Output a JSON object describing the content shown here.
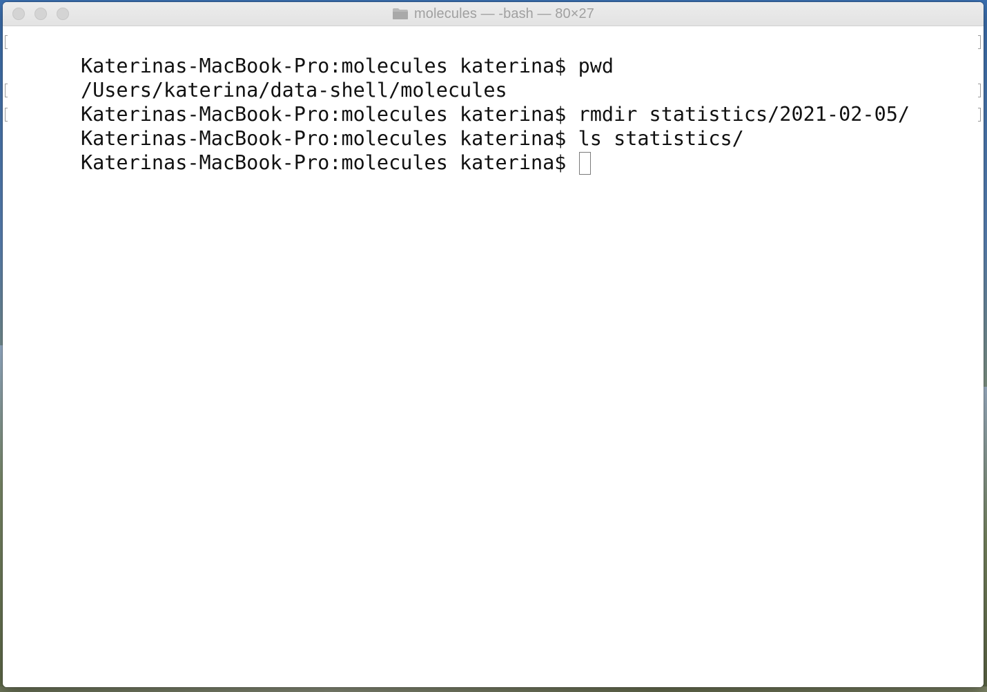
{
  "window": {
    "title": "molecules — -bash — 80×27"
  },
  "icons": {
    "title_icon": "folder-icon",
    "cursor": "block-cursor"
  },
  "colors": {
    "terminal_background": "#ffffff",
    "terminal_text": "#111111",
    "title_text": "#a0a0a0"
  },
  "terminal": {
    "lines": [
      {
        "text": "Katerinas-MacBook-Pro:molecules katerina$ pwd",
        "marked": true
      },
      {
        "text": "/Users/katerina/data-shell/molecules",
        "marked": false
      },
      {
        "text": "Katerinas-MacBook-Pro:molecules katerina$ rmdir statistics/2021-02-05/",
        "marked": true
      },
      {
        "text": "Katerinas-MacBook-Pro:molecules katerina$ ls statistics/",
        "marked": true
      }
    ],
    "current_prompt": "Katerinas-MacBook-Pro:molecules katerina$ "
  }
}
